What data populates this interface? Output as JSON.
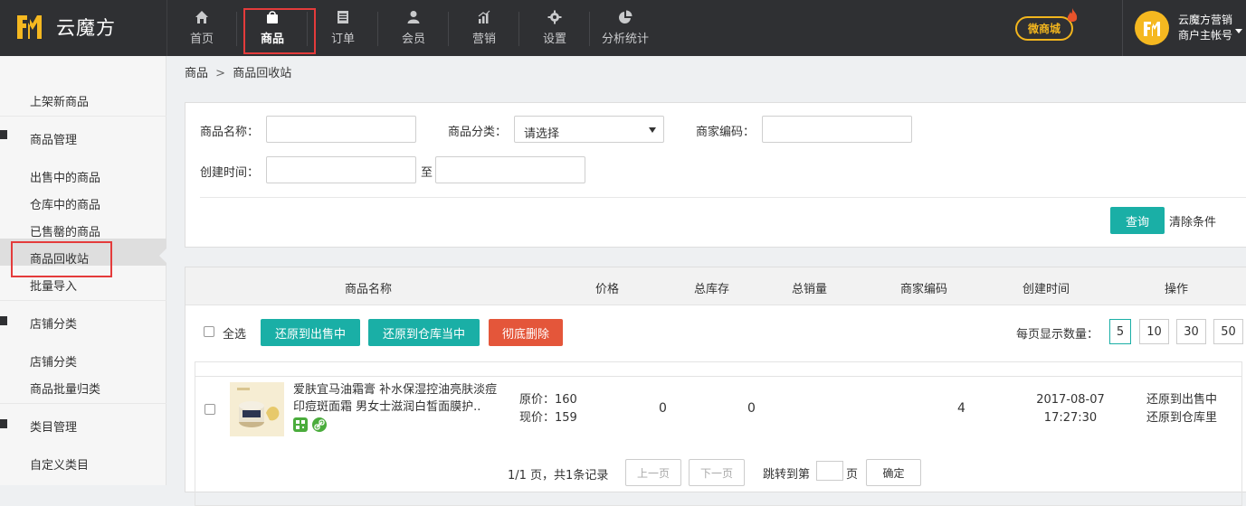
{
  "brand": {
    "name": "云魔方"
  },
  "nav": [
    {
      "label": "首页",
      "icon": "home-icon"
    },
    {
      "label": "商品",
      "icon": "bag-icon",
      "active": true
    },
    {
      "label": "订单",
      "icon": "document-icon"
    },
    {
      "label": "会员",
      "icon": "person-icon"
    },
    {
      "label": "营销",
      "icon": "bar-chart-icon"
    },
    {
      "label": "设置",
      "icon": "gear-icon"
    },
    {
      "label": "分析统计",
      "icon": "pie-chart-icon"
    }
  ],
  "header": {
    "wsc_label": "微商城",
    "user_line1": "云魔方营销",
    "user_line2": "商户主帐号"
  },
  "sidebar": {
    "top_item": "上架新商品",
    "group1": "商品管理",
    "group1_items": [
      "出售中的商品",
      "仓库中的商品",
      "已售罄的商品",
      "商品回收站",
      "批量导入"
    ],
    "group2": "店铺分类",
    "group2_items": [
      "店铺分类",
      "商品批量归类"
    ],
    "group3": "类目管理",
    "group3_items": [
      "自定义类目"
    ]
  },
  "breadcrumb": {
    "root": "商品",
    "sep": ">",
    "current": "商品回收站"
  },
  "filter": {
    "name_label": "商品名称：",
    "category_label": "商品分类：",
    "category_value": "请选择",
    "code_label": "商家编码：",
    "time_label": "创建时间：",
    "to_label": "至",
    "query_button": "查询",
    "clear_link": "清除条件"
  },
  "table": {
    "headers": [
      "商品名称",
      "价格",
      "总库存",
      "总销量",
      "商家编码",
      "创建时间",
      "操作"
    ],
    "select_all": "全选",
    "btn_restore_sale": "还原到出售中",
    "btn_restore_stock": "还原到仓库当中",
    "btn_delete": "彻底删除",
    "per_page_label": "每页显示数量：",
    "per_page_options": [
      "5",
      "10",
      "30",
      "50"
    ],
    "per_page_selected": "5",
    "rows": [
      {
        "name": "爱肤宜马油霜膏 补水保湿控油亮肤淡痘印痘斑面霜 男女士滋润白皙面膜护..",
        "original_price": "原价：160",
        "current_price": "现价：159",
        "stock": "0",
        "sales": "0",
        "code": "4",
        "date": "2017-08-07",
        "time": "17:27:30",
        "op1": "还原到出售中",
        "op2": "还原到仓库里"
      }
    ]
  },
  "pager": {
    "info": "1/1 页，共1条记录",
    "prev": "上一页",
    "next": "下一页",
    "jump_label": "跳转到第",
    "page_unit": "页",
    "ok": "确定"
  },
  "colors": {
    "teal": "#1aafa6",
    "danger": "#e4563a",
    "highlight": "#e43b3b",
    "topbar": "#2f3033",
    "gold": "#f2b51d"
  }
}
